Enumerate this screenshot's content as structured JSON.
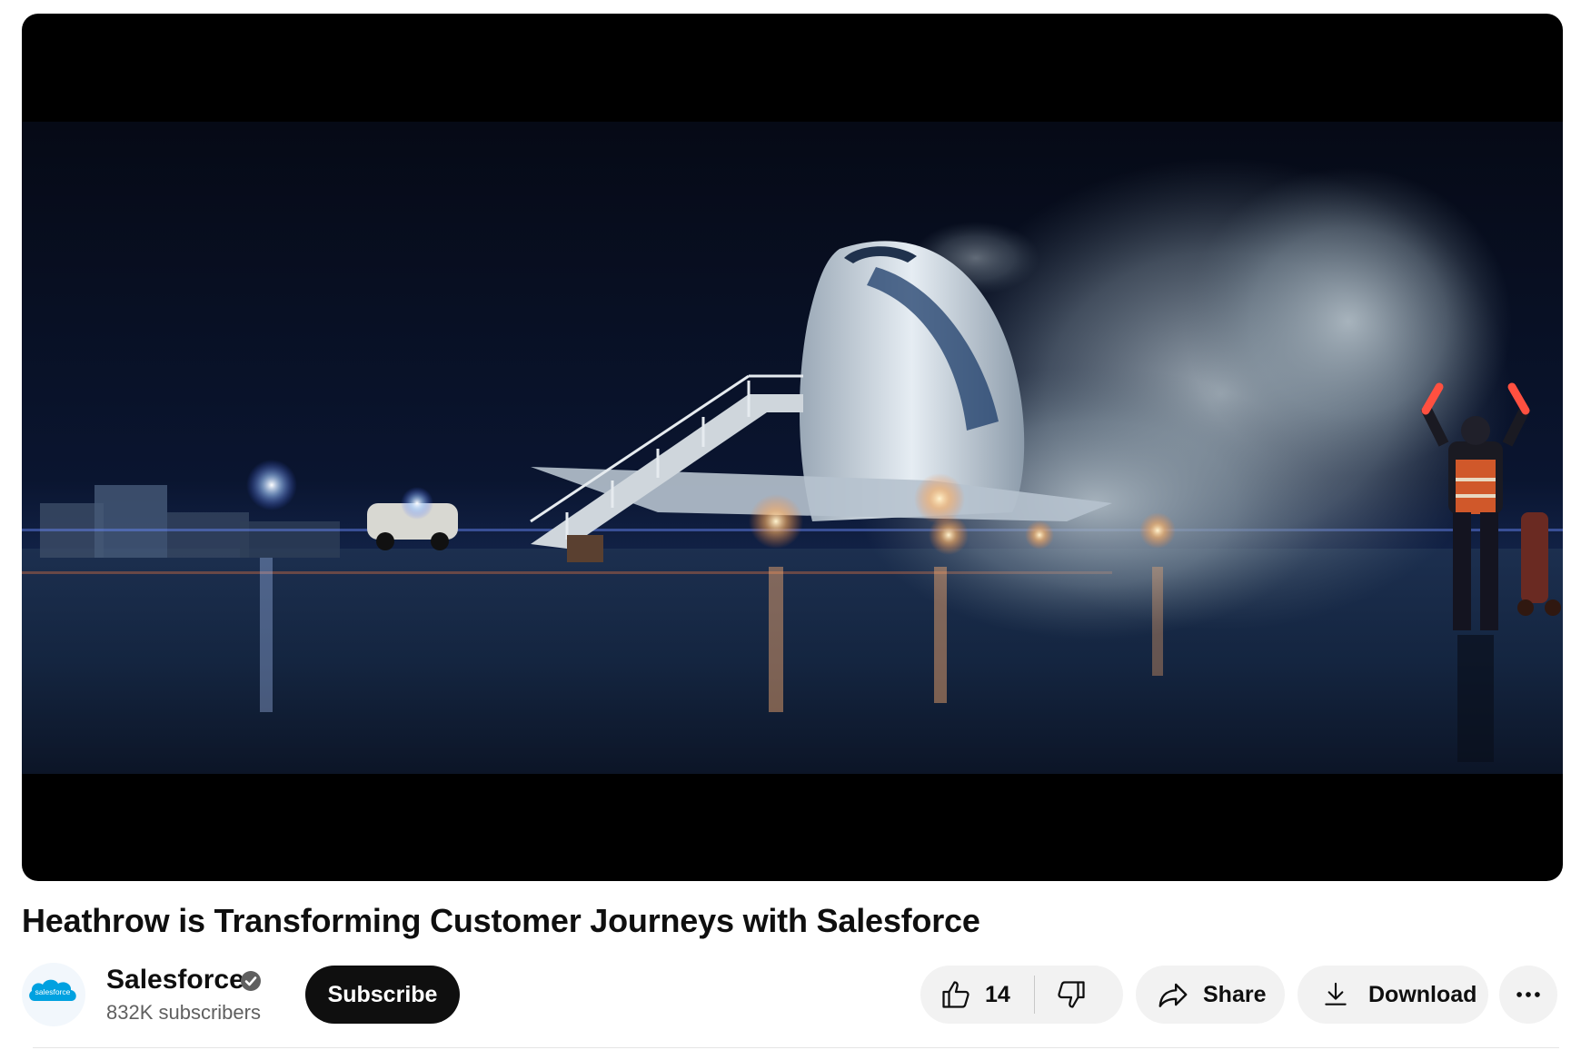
{
  "video": {
    "title": "Heathrow is Transforming Customer Journeys with Salesforce",
    "thumbnail_description_icon": "airport-night-scene"
  },
  "channel": {
    "name": "Salesforce",
    "avatar_text": "salesforce",
    "subscribers": "832K subscribers",
    "verified_icon": "verified-check-icon"
  },
  "actions": {
    "subscribe_label": "Subscribe",
    "like_count": "14",
    "share_label": "Share",
    "download_label": "Download"
  },
  "colors": {
    "subscribe_bg": "#0f0f0f",
    "pill_bg": "#f2f2f2",
    "salesforce_blue": "#00a1e0"
  }
}
